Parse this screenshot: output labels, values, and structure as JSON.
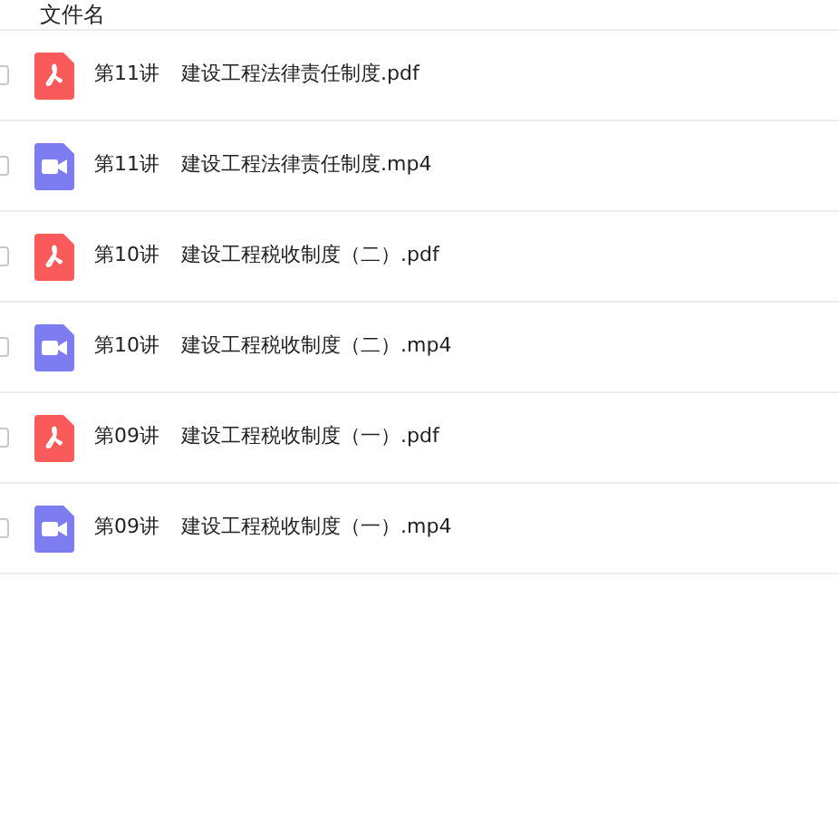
{
  "header": {
    "label": "文件名"
  },
  "files": [
    {
      "kind": "pdf",
      "checked": false,
      "lecture": "第11讲",
      "name": "建设工程法律责任制度.pdf"
    },
    {
      "kind": "video",
      "checked": false,
      "lecture": "第11讲",
      "name": "建设工程法律责任制度.mp4"
    },
    {
      "kind": "pdf",
      "checked": false,
      "lecture": "第10讲",
      "name": "建设工程税收制度（二）.pdf"
    },
    {
      "kind": "video",
      "checked": false,
      "lecture": "第10讲",
      "name": "建设工程税收制度（二）.mp4"
    },
    {
      "kind": "pdf",
      "checked": false,
      "lecture": "第09讲",
      "name": "建设工程税收制度（一）.pdf"
    },
    {
      "kind": "video",
      "checked": false,
      "lecture": "第09讲",
      "name": "建设工程税收制度（一）.mp4"
    }
  ]
}
